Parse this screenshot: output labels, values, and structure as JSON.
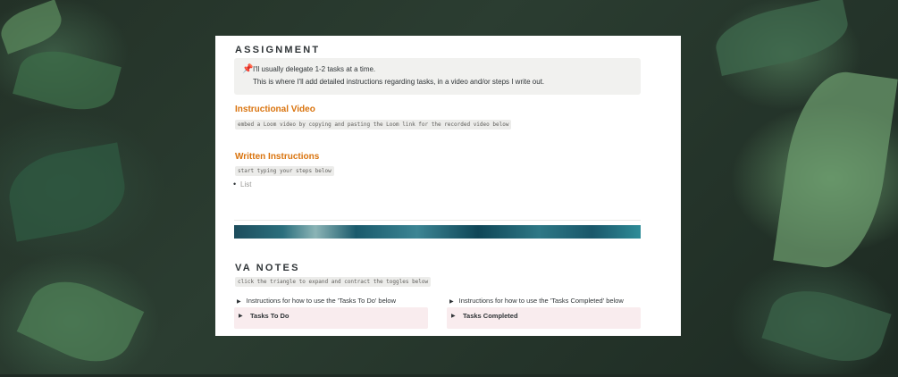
{
  "assignment": {
    "heading": "ASSIGNMENT",
    "callout_icon": "pushpin-icon",
    "callout_line1": "I'll usually delegate 1-2 tasks at a time.",
    "callout_line2": "This is where I'll add detailed instructions regarding tasks, in a video and/or steps I write out."
  },
  "video": {
    "heading": "Instructional Video",
    "code_note": "embed a Loom video by copying and pasting the Loom link for the recorded video below"
  },
  "written": {
    "heading": "Written Instructions",
    "code_note": "start typing your steps below",
    "list_placeholder": "List"
  },
  "va_notes": {
    "heading": "VA NOTES",
    "code_note": "click the triangle to expand and contract the toggles below",
    "left": {
      "instruction": "Instructions for how to use the 'Tasks To Do' below",
      "toggle": "Tasks To Do"
    },
    "right": {
      "instruction": "Instructions for how to use the 'Tasks Completed' below",
      "toggle": "Tasks Completed"
    }
  },
  "colors": {
    "accent_orange": "#d9730d",
    "callout_bg": "#f1f1ef",
    "toggle_bg": "#f9ecee"
  }
}
